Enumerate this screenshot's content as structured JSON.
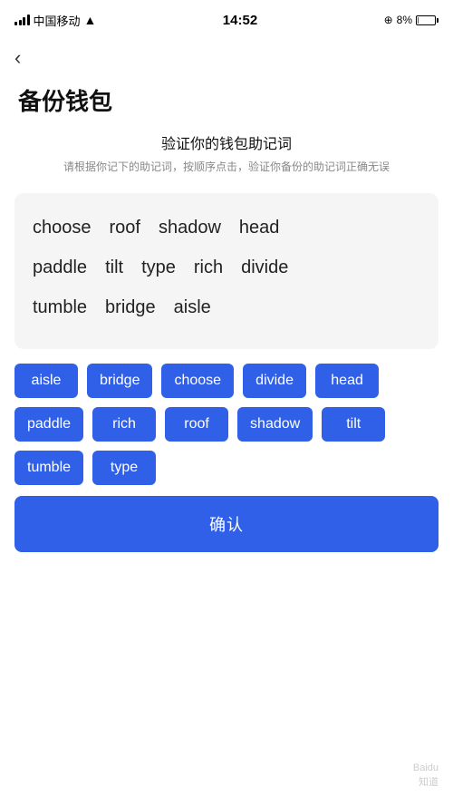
{
  "statusBar": {
    "carrier": "中国移动",
    "time": "14:52",
    "batteryPercent": "8%",
    "batteryLow": true
  },
  "nav": {
    "backLabel": "‹"
  },
  "page": {
    "title": "备份钱包"
  },
  "sectionHeader": {
    "title": "验证你的钱包助记词",
    "desc": "请根据你记下的助记词，按顺序点击，验证你备份的助记词正确无误"
  },
  "displayWords": {
    "row1": [
      "choose",
      "roof",
      "shadow",
      "head"
    ],
    "row2": [
      "paddle",
      "tilt",
      "type",
      "rich",
      "divide"
    ],
    "row3": [
      "tumble",
      "bridge",
      "aisle"
    ]
  },
  "wordButtons": [
    "aisle",
    "bridge",
    "choose",
    "divide",
    "head",
    "paddle",
    "rich",
    "roof",
    "shadow",
    "tilt",
    "tumble",
    "type"
  ],
  "confirmBtn": {
    "label": "确认"
  },
  "watermark": {
    "line1": "Baidu",
    "line2": "知道"
  }
}
